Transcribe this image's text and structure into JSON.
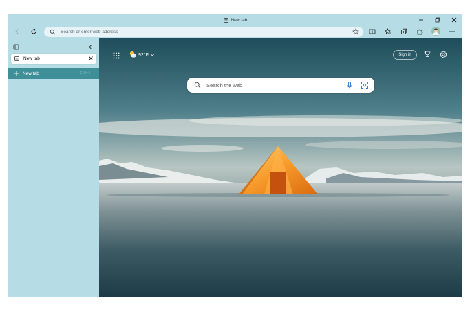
{
  "window": {
    "title": "New tab"
  },
  "toolbar": {
    "address_placeholder": "Search or enter web address",
    "icons": [
      "back-icon",
      "refresh-icon",
      "split-screen-icon",
      "favorites-icon",
      "collections-icon",
      "extensions-icon",
      "profile-avatar",
      "more-icon"
    ]
  },
  "sidebar": {
    "tabs": [
      {
        "label": "New tab"
      }
    ],
    "new_tab_label": "New tab",
    "new_tab_shortcut": "Ctrl+T"
  },
  "newtab_page": {
    "weather_temp": "92°F",
    "signin_label": "Sign in",
    "search_placeholder": "Search the web"
  },
  "colors": {
    "frame": "#b6dde5",
    "sidebar_active": "#3f8f98",
    "address_bg": "#e7f3f6"
  }
}
